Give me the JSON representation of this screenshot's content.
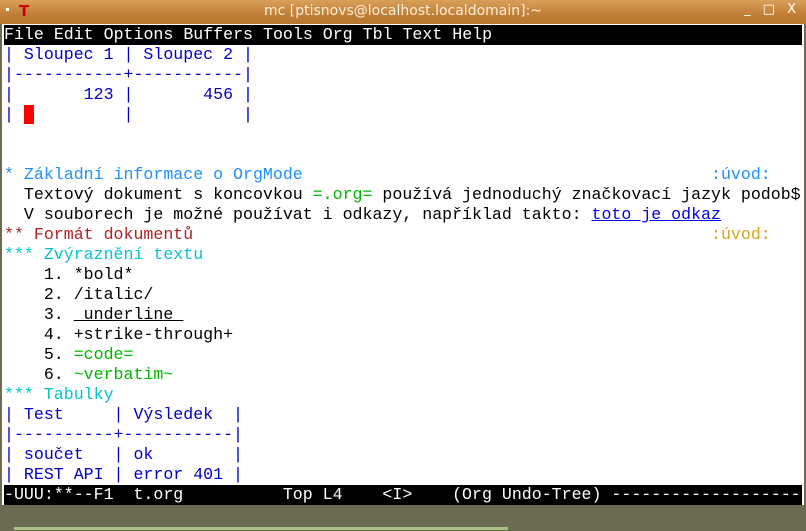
{
  "window": {
    "title": "mc [ptisnovs@localhost.localdomain]:~",
    "app_icon": "T",
    "controls": "_ □ X"
  },
  "menubar": {
    "items": [
      "File",
      "Edit",
      "Options",
      "Buffers",
      "Tools",
      "Org",
      "Tbl",
      "Text",
      "Help"
    ]
  },
  "rows": [
    {
      "segs": [
        {
          "t": "| Sloupec 1 | Sloupec 2 |",
          "c": "tbl"
        }
      ]
    },
    {
      "segs": [
        {
          "t": "|-----------+-----------|",
          "c": "tbl"
        }
      ]
    },
    {
      "segs": [
        {
          "t": "|       123 |       456 |",
          "c": "tbl"
        }
      ]
    },
    {
      "segs": [
        {
          "t": "| ",
          "c": "tbl"
        },
        {
          "t": " ",
          "c": "cursor"
        },
        {
          "t": "         |           |",
          "c": "tbl"
        }
      ]
    },
    {
      "segs": []
    },
    {
      "segs": []
    },
    {
      "segs": [
        {
          "t": "* Základní informace o OrgMode                                         ",
          "c": "h1"
        },
        {
          "t": ":úvod:",
          "c": "h1"
        }
      ]
    },
    {
      "segs": [
        {
          "t": "  Textový dokument s koncovkou ",
          "c": ""
        },
        {
          "t": "=.org=",
          "c": "code"
        },
        {
          "t": " používá jednoduchý značkovací jazyk podob$",
          "c": ""
        }
      ]
    },
    {
      "segs": [
        {
          "t": "  V souborech je možné používat i odkazy, například takto: ",
          "c": ""
        },
        {
          "t": "toto je odkaz",
          "c": "link"
        }
      ]
    },
    {
      "segs": [
        {
          "t": "** Formát dokumentů                                                    ",
          "c": "h2"
        },
        {
          "t": ":úvod:",
          "c": "tag"
        }
      ]
    },
    {
      "segs": [
        {
          "t": "*** Zvýraznění textu",
          "c": "h3"
        }
      ]
    },
    {
      "segs": [
        {
          "t": "    1. *bold*",
          "c": ""
        }
      ]
    },
    {
      "segs": [
        {
          "t": "    2. /italic/",
          "c": ""
        }
      ]
    },
    {
      "segs": [
        {
          "t": "    3. ",
          "c": ""
        },
        {
          "t": "_underline_",
          "c": "ul"
        }
      ]
    },
    {
      "segs": [
        {
          "t": "    4. +strike-through+",
          "c": ""
        }
      ]
    },
    {
      "segs": [
        {
          "t": "    5. ",
          "c": ""
        },
        {
          "t": "=code=",
          "c": "code"
        }
      ]
    },
    {
      "segs": [
        {
          "t": "    6. ",
          "c": ""
        },
        {
          "t": "~verbatim~",
          "c": "code"
        }
      ]
    },
    {
      "segs": [
        {
          "t": "*** Tabulky",
          "c": "h3"
        }
      ]
    },
    {
      "segs": [
        {
          "t": "| Test     | Výsledek  |",
          "c": "tbl"
        }
      ]
    },
    {
      "segs": [
        {
          "t": "|----------+-----------|",
          "c": "tbl"
        }
      ]
    },
    {
      "segs": [
        {
          "t": "| součet   | ok        |",
          "c": "tbl"
        }
      ]
    },
    {
      "segs": [
        {
          "t": "| REST API | error 401 |",
          "c": "tbl"
        }
      ]
    }
  ],
  "modeline": "-UUU:**--F1  t.org          Top L4    <I>    (Org Undo-Tree) -------------------"
}
